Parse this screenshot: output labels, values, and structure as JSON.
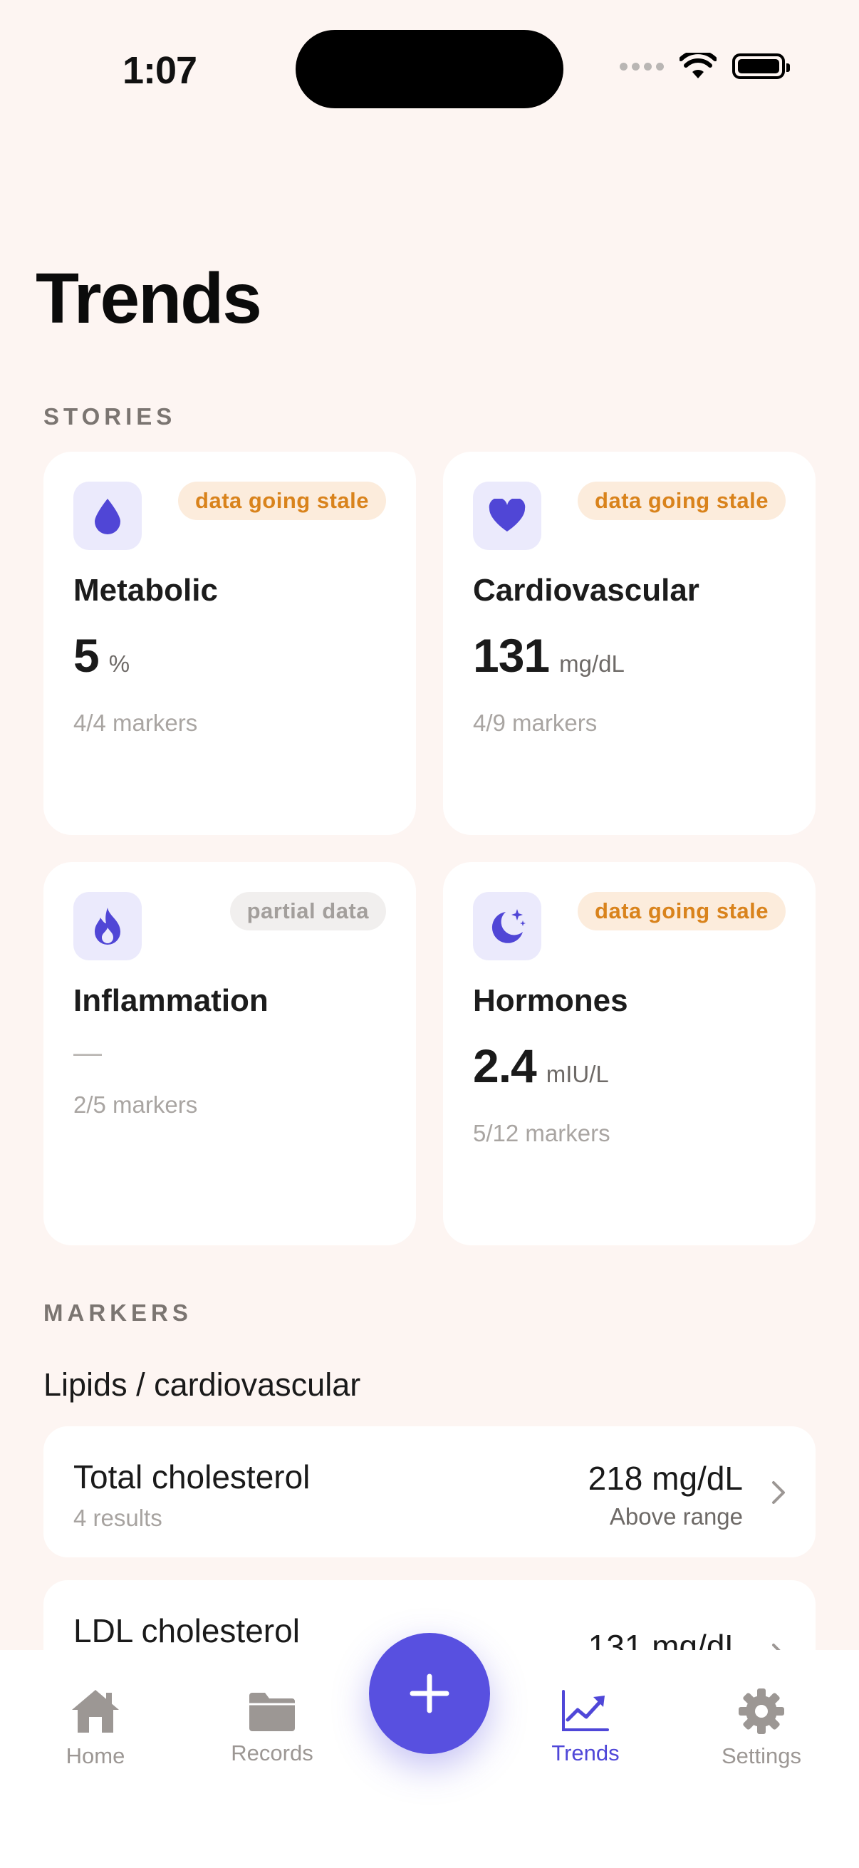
{
  "status_bar": {
    "time": "1:07"
  },
  "page": {
    "title": "Trends"
  },
  "sections": {
    "stories": "STORIES",
    "markers": "MARKERS"
  },
  "stories": [
    {
      "icon": "drop-icon",
      "badge": "data going stale",
      "badge_kind": "stale",
      "title": "Metabolic",
      "value": "5",
      "unit": "%",
      "markers": "4/4 markers"
    },
    {
      "icon": "heart-icon",
      "badge": "data going stale",
      "badge_kind": "stale",
      "title": "Cardiovascular",
      "value": "131",
      "unit": "mg/dL",
      "markers": "4/9 markers"
    },
    {
      "icon": "flame-icon",
      "badge": "partial data",
      "badge_kind": "partial",
      "title": "Inflammation",
      "value": "—",
      "unit": "",
      "markers": "2/5 markers"
    },
    {
      "icon": "moon-stars-icon",
      "badge": "data going stale",
      "badge_kind": "stale",
      "title": "Hormones",
      "value": "2.4",
      "unit": "mIU/L",
      "markers": "5/12 markers"
    }
  ],
  "marker_group": {
    "title": "Lipids / cardiovascular",
    "items": [
      {
        "name": "Total cholesterol",
        "results": "4 results",
        "value": "218 mg/dL",
        "status": "Above range"
      },
      {
        "name": "LDL cholesterol",
        "results": "",
        "value": "131 mg/dL",
        "status": ""
      }
    ]
  },
  "tabbar": {
    "items": [
      {
        "label": "Home",
        "icon": "house-icon",
        "active": false
      },
      {
        "label": "Records",
        "icon": "folder-icon",
        "active": false
      },
      {
        "label": "Trends",
        "icon": "chart-line-icon",
        "active": true
      },
      {
        "label": "Settings",
        "icon": "gear-icon",
        "active": false
      }
    ],
    "add_icon": "plus-icon"
  },
  "colors": {
    "accent": "#5850e0",
    "background": "#fdf5f2",
    "stale_badge": "#d9831c",
    "partial_badge": "#a39f9c"
  }
}
